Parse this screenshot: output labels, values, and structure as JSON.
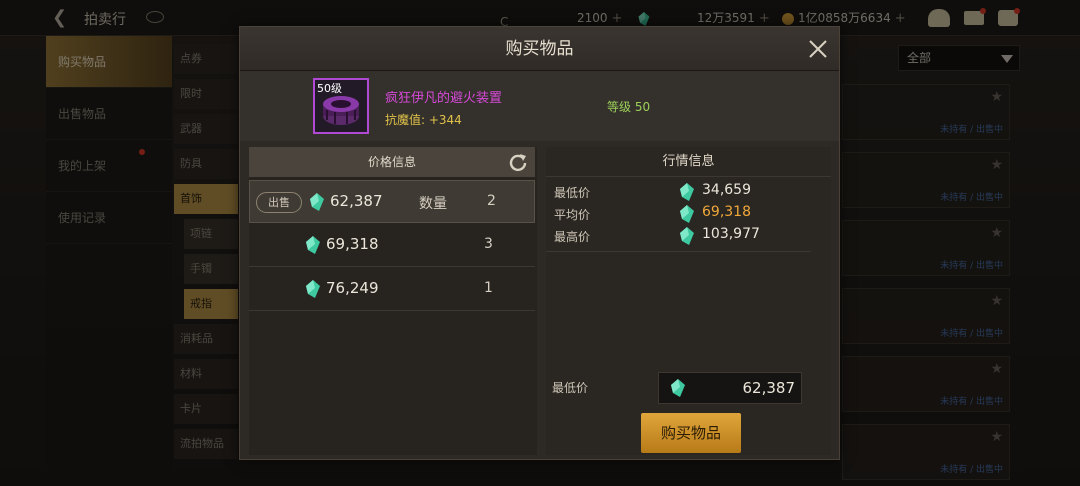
{
  "topbar": {
    "title": "拍卖行",
    "currency_1": "2100",
    "currency_2": "12万3591",
    "currency_3": "1亿0858万6634"
  },
  "left_nav": {
    "items": [
      {
        "label": "购买物品",
        "active": true
      },
      {
        "label": "出售物品",
        "active": false
      },
      {
        "label": "我的上架",
        "active": false
      },
      {
        "label": "使用记录",
        "active": false
      }
    ]
  },
  "sub_nav": {
    "items": [
      {
        "label": "点券"
      },
      {
        "label": "限时"
      },
      {
        "label": "武器"
      },
      {
        "label": "防具"
      },
      {
        "label": "首饰",
        "active": true
      },
      {
        "label": "项链",
        "sub": true
      },
      {
        "label": "手镯",
        "sub": true
      },
      {
        "label": "戒指",
        "sub": true,
        "active": true
      },
      {
        "label": "消耗品"
      },
      {
        "label": "材料"
      },
      {
        "label": "卡片"
      },
      {
        "label": "流拍物品"
      }
    ]
  },
  "filter": {
    "selected": "全部"
  },
  "bg_rows": {
    "status": "未持有 / 出售中"
  },
  "modal": {
    "title": "购买物品",
    "item": {
      "level_badge": "50级",
      "name": "疯狂伊凡的避火装置",
      "stat": "抗魔值: +344",
      "level": "等级 50",
      "rarity_color": "#b04ad4"
    },
    "price_panel": {
      "title": "价格信息",
      "sell_label": "出售",
      "qty_label": "数量",
      "rows": [
        {
          "price": "62,387",
          "qty": "2"
        },
        {
          "price": "69,318",
          "qty": "3"
        },
        {
          "price": "76,249",
          "qty": "1"
        }
      ]
    },
    "market_panel": {
      "title": "行情信息",
      "rows": [
        {
          "label": "最低价",
          "value": "34,659"
        },
        {
          "label": "平均价",
          "value": "69,318"
        },
        {
          "label": "最高价",
          "value": "103,977"
        }
      ],
      "min_price_label": "最低价",
      "min_price_value": "62,387",
      "buy_label": "购买物品"
    }
  },
  "colors": {
    "gem": "#3ec9a0",
    "accent_gold": "#d9a039",
    "average_price": "#f0a83a"
  }
}
